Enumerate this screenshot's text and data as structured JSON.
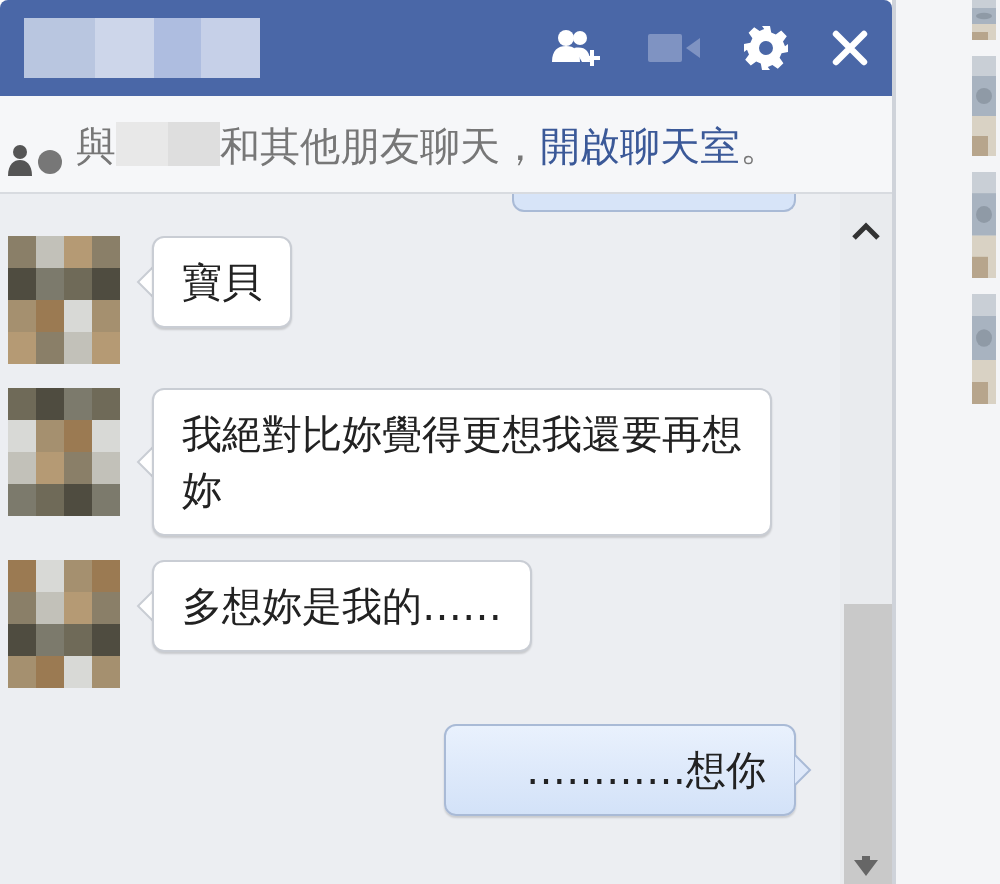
{
  "header": {
    "name_redacted": true,
    "buttons": [
      {
        "kind": "add-friend",
        "disabled": false
      },
      {
        "kind": "video",
        "disabled": true
      },
      {
        "kind": "settings",
        "disabled": false
      },
      {
        "kind": "close",
        "disabled": false
      }
    ]
  },
  "notice": {
    "before": "與",
    "name_redacted": true,
    "after": "和其他朋友聊天，",
    "link": "開啟聊天室",
    "end": "。"
  },
  "messages": [
    {
      "kind": "sent-cut"
    },
    {
      "kind": "received",
      "text": "寶貝"
    },
    {
      "kind": "received",
      "text": "我絕對比妳覺得更想我還要再想妳"
    },
    {
      "kind": "received",
      "text": "多想妳是我的……"
    },
    {
      "kind": "sent",
      "text": "…………想你"
    }
  ]
}
